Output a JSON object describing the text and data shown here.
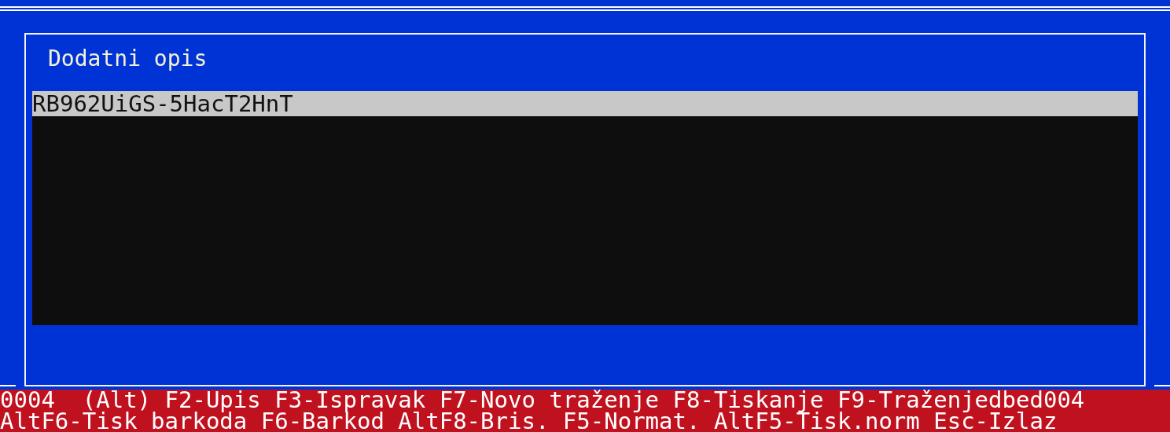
{
  "dialog": {
    "title": "Dodatni opis",
    "rows": [
      {
        "text": "RB962UiGS-5HacT2HnT",
        "selected": true
      }
    ]
  },
  "status_bar": {
    "lines": [
      "0004  (Alt) F2-Upis F3-Ispravak F7-Novo traženje F8-Tiskanje F9-Traženjedbed004",
      "AltF6-Tisk barkoda F6-Barkod AltF8-Bris. F5-Normat. AltF5-Tisk.norm Esc-Izlaz"
    ]
  }
}
